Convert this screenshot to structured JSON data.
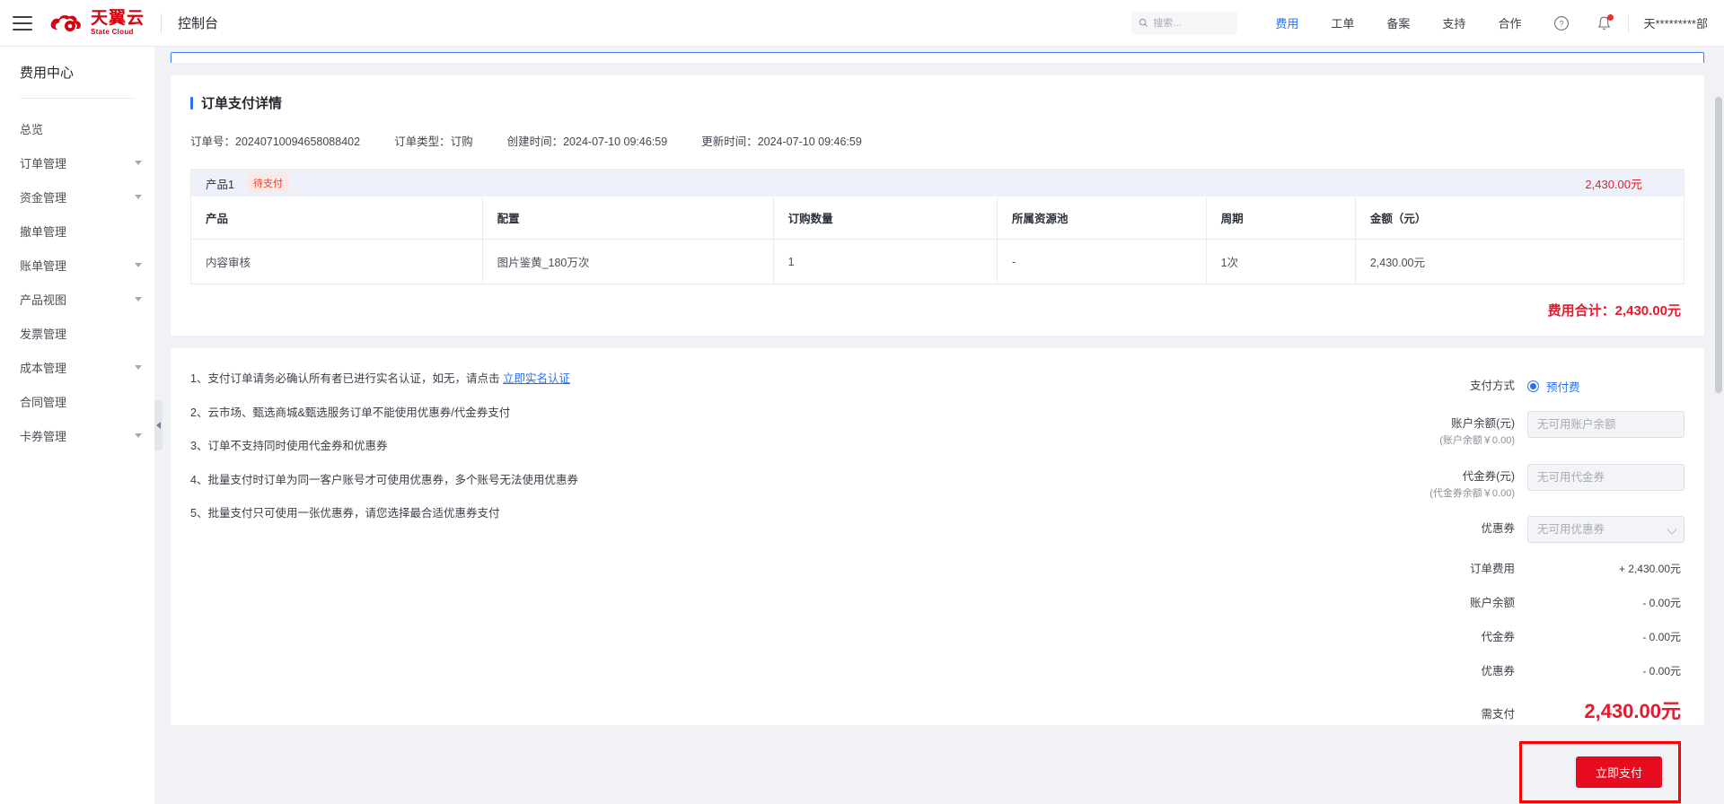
{
  "header": {
    "menu_icon": "hamburger-icon",
    "logo_cn": "天翼云",
    "logo_en": "State Cloud",
    "console_title": "控制台",
    "search_placeholder": "搜索...",
    "nav": [
      {
        "label": "费用",
        "active": true
      },
      {
        "label": "工单",
        "active": false
      },
      {
        "label": "备案",
        "active": false
      },
      {
        "label": "支持",
        "active": false
      },
      {
        "label": "合作",
        "active": false
      }
    ],
    "help_icon": "question-circle-icon",
    "bell_icon": "bell-icon",
    "user_name": "天*********部"
  },
  "sidebar": {
    "title": "费用中心",
    "items": [
      {
        "label": "总览",
        "expandable": false
      },
      {
        "label": "订单管理",
        "expandable": true
      },
      {
        "label": "资金管理",
        "expandable": true
      },
      {
        "label": "撤单管理",
        "expandable": false
      },
      {
        "label": "账单管理",
        "expandable": true
      },
      {
        "label": "产品视图",
        "expandable": true
      },
      {
        "label": "发票管理",
        "expandable": false
      },
      {
        "label": "成本管理",
        "expandable": true
      },
      {
        "label": "合同管理",
        "expandable": false
      },
      {
        "label": "卡券管理",
        "expandable": true
      }
    ]
  },
  "order": {
    "section_title": "订单支付详情",
    "meta": [
      {
        "label": "订单号：",
        "value": "20240710094658088402"
      },
      {
        "label": "订单类型：",
        "value": "订购"
      },
      {
        "label": "创建时间：",
        "value": "2024-07-10 09:46:59"
      },
      {
        "label": "更新时间：",
        "value": "2024-07-10 09:46:59"
      }
    ],
    "product_group": {
      "name": "产品1",
      "status": "待支付",
      "amount": "2,430.00元"
    },
    "table": {
      "headers": [
        "产品",
        "配置",
        "订购数量",
        "所属资源池",
        "周期",
        "金额（元）"
      ],
      "rows": [
        {
          "product": "内容审核",
          "config": "图片鉴黄_180万次",
          "quantity": "1",
          "pool": "-",
          "period": "1次",
          "amount": "2,430.00元"
        }
      ]
    },
    "total_label": "费用合计：",
    "total_value": "2,430.00元"
  },
  "notes": [
    {
      "index": "1、",
      "text": "支付订单请务必确认所有者已进行实名认证，如无，请点击 ",
      "link": "立即实名认证"
    },
    {
      "index": "2、",
      "text": "云市场、甄选商城&甄选服务订单不能使用优惠券/代金券支付",
      "link": ""
    },
    {
      "index": "3、",
      "text": "订单不支持同时使用代金券和优惠券",
      "link": ""
    },
    {
      "index": "4、",
      "text": "批量支付时订单为同一客户账号才可使用优惠券，多个账号无法使用优惠券",
      "link": ""
    },
    {
      "index": "5、",
      "text": "批量支付只可使用一张优惠券，请您选择最合适优惠券支付",
      "link": ""
    }
  ],
  "payment": {
    "method_label": "支付方式",
    "method_option": "预付费",
    "method_selected": true,
    "balance_label": "账户余额(元)",
    "balance_sub": "(账户余额￥0.00)",
    "balance_placeholder": "无可用账户余额",
    "balance_value": "",
    "voucher_label": "代金券(元)",
    "voucher_sub": "(代金券余额￥0.00)",
    "voucher_placeholder": "无可用代金券",
    "voucher_value": "",
    "coupon_label": "优惠券",
    "coupon_placeholder": "无可用优惠券",
    "coupon_value": "",
    "summary": [
      {
        "label": "订单费用",
        "value": "+ 2,430.00元"
      },
      {
        "label": "账户余额",
        "value": "- 0.00元"
      },
      {
        "label": "代金券",
        "value": "- 0.00元"
      },
      {
        "label": "优惠券",
        "value": "- 0.00元"
      }
    ],
    "grand_label": "需支付",
    "grand_value": "2,430.00元",
    "pay_button": "立即支付"
  },
  "colors": {
    "brand_red": "#d7000f",
    "accent_blue": "#2b6ef5",
    "price_red": "#e8192c",
    "pay_button": "#e60b1e",
    "highlight_box": "#ff0000"
  }
}
